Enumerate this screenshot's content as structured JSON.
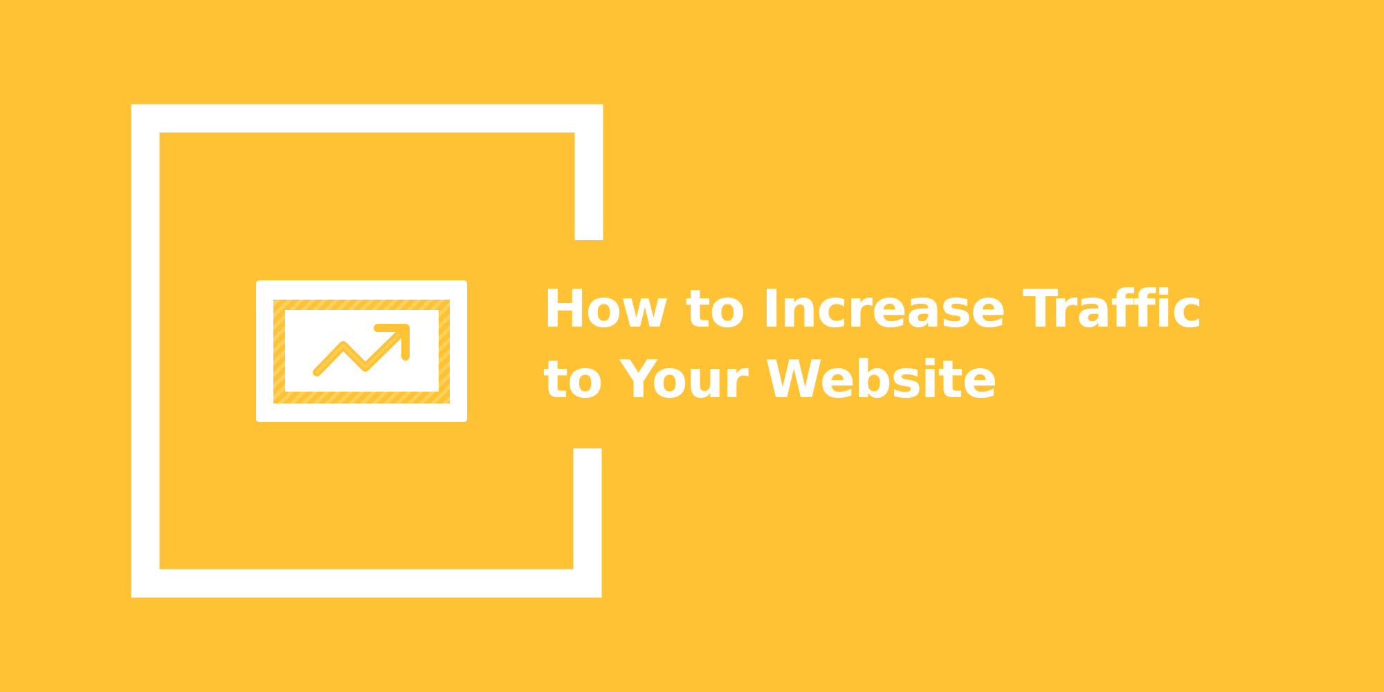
{
  "banner": {
    "background_color": "#FFC235",
    "accent_color": "#FFFFFF",
    "title_lines": [
      "How to Increase Traffic",
      "to Your Website"
    ],
    "icon": "trending-up-chart-icon"
  }
}
